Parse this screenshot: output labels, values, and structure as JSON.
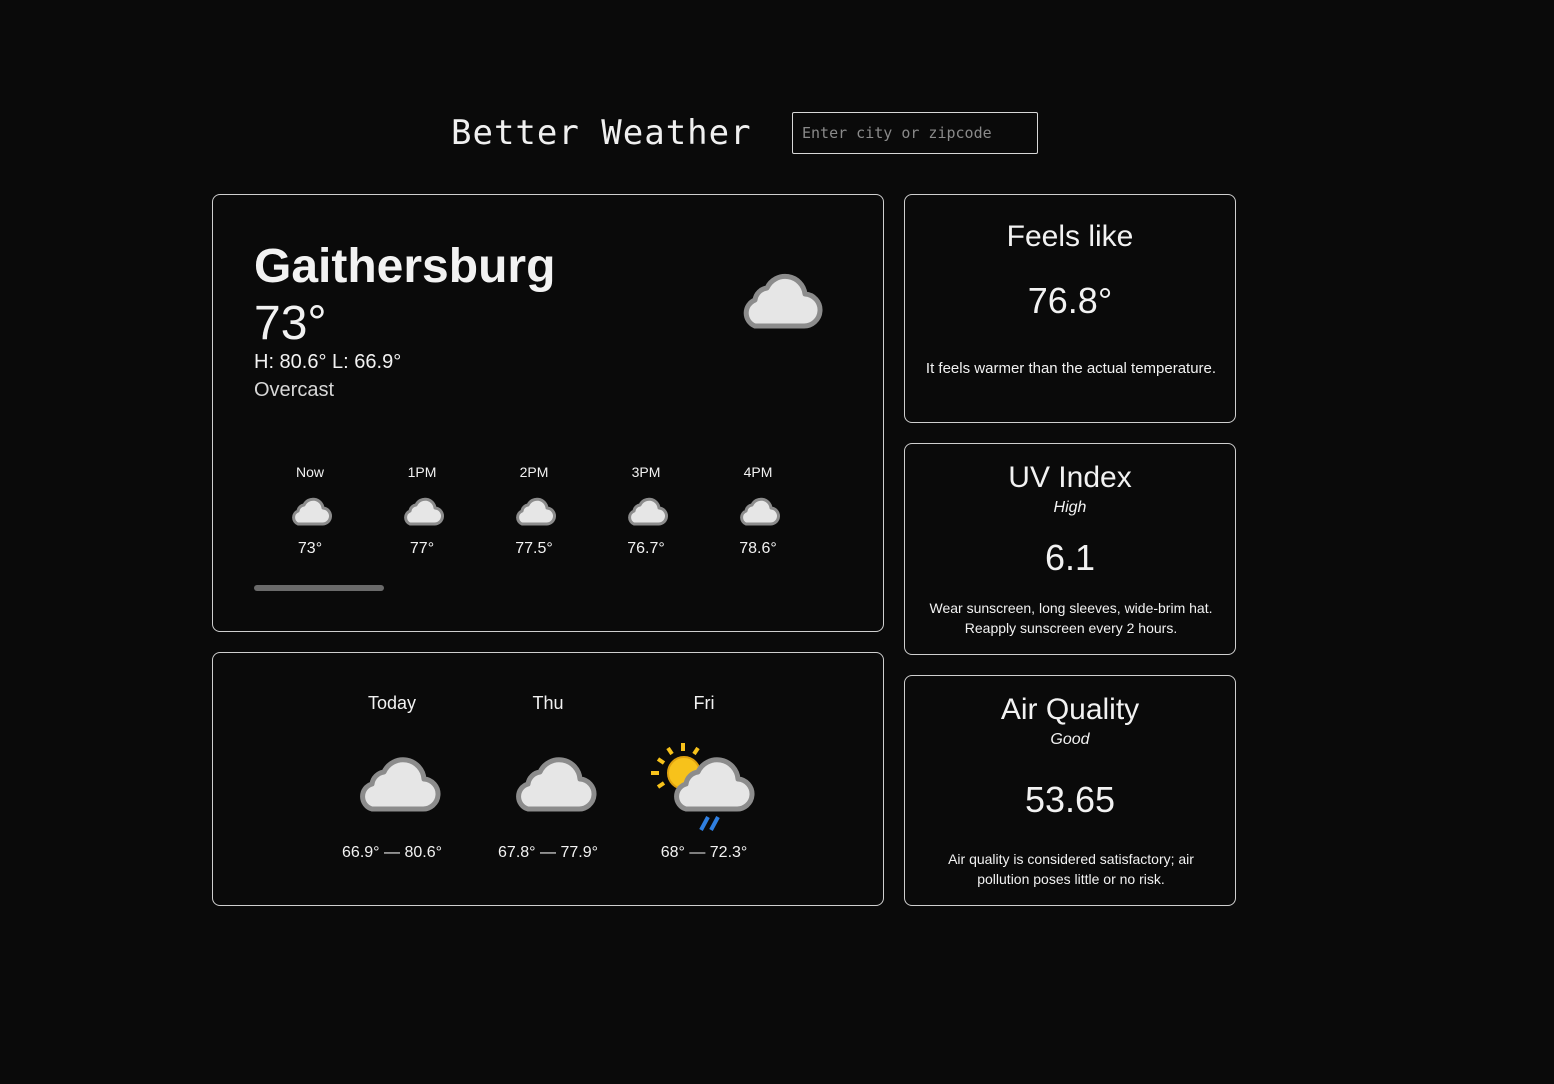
{
  "app": {
    "title": "Better Weather",
    "search_placeholder": "Enter city or zipcode",
    "search_value": ""
  },
  "current": {
    "city": "Gaithersburg",
    "temp": "73°",
    "high": "H: 80.6°",
    "low": "L: 66.9°",
    "condition": "Overcast",
    "icon": "cloud-icon"
  },
  "hourly": [
    {
      "time": "Now",
      "temp": "73°",
      "icon": "cloud-icon"
    },
    {
      "time": "1PM",
      "temp": "77°",
      "icon": "cloud-icon"
    },
    {
      "time": "2PM",
      "temp": "77.5°",
      "icon": "cloud-icon"
    },
    {
      "time": "3PM",
      "temp": "76.7°",
      "icon": "cloud-icon"
    },
    {
      "time": "4PM",
      "temp": "78.6°",
      "icon": "cloud-icon"
    }
  ],
  "daily": [
    {
      "day": "Today",
      "range": "66.9° — 80.6°",
      "icon": "cloud-icon"
    },
    {
      "day": "Thu",
      "range": "67.8° — 77.9°",
      "icon": "cloud-icon"
    },
    {
      "day": "Fri",
      "range": "68° — 72.3°",
      "icon": "sun-cloud-rain-icon"
    }
  ],
  "feels_like": {
    "title": "Feels like",
    "value": "76.8°",
    "description": "It feels warmer than the actual temperature."
  },
  "uv_index": {
    "title": "UV Index",
    "level": "High",
    "value": "6.1",
    "description": "Wear sunscreen, long sleeves, wide-brim hat. Reapply sunscreen every 2 hours."
  },
  "air_quality": {
    "title": "Air Quality",
    "level": "Good",
    "value": "53.65",
    "description": "Air quality is considered satisfactory; air pollution poses little or no risk."
  },
  "colors": {
    "background": "#0a0a0a",
    "card_border": "#cfcfcf",
    "text": "#f2f2f2",
    "cloud_fill": "#e6e6e6",
    "cloud_outline": "#8c8c8c",
    "sun": "#f7c21b",
    "rain": "#2f7fe0"
  }
}
